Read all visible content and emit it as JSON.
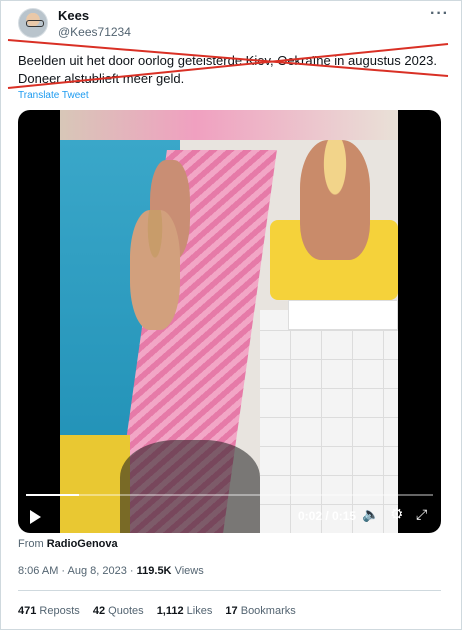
{
  "author": {
    "name": "Kees",
    "handle": "@Kees71234"
  },
  "tweet": {
    "line1": "Beelden uit het door oorlog geteisterde Kiev, Oekraïne in augustus 2023.",
    "line2": "Doneer alstublieft meer geld.",
    "translate": "Translate Tweet"
  },
  "video": {
    "time": "0:02 / 0:15",
    "progress": 0.13
  },
  "source": {
    "prefix": "From",
    "name": "RadioGenova"
  },
  "meta": {
    "time_date": "8:06 AM · Aug 8, 2023 · ",
    "views_count": "119.5K",
    "views_label": " Views"
  },
  "stats": {
    "reposts": {
      "count": "471",
      "label": " Reposts"
    },
    "quotes": {
      "count": "42",
      "label": " Quotes"
    },
    "likes": {
      "count": "1,112",
      "label": " Likes"
    },
    "bookmarks": {
      "count": "17",
      "label": " Bookmarks"
    }
  },
  "colors": {
    "link": "#1d9bf0",
    "strike": "#d93025"
  }
}
